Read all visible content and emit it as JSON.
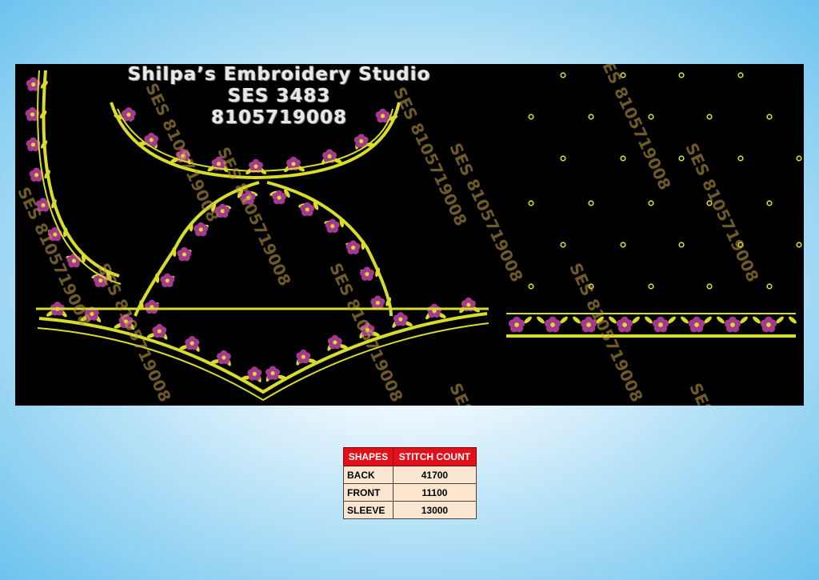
{
  "studio": {
    "name": "Shilpa’s Embroidery Studio",
    "code": "SES 3483",
    "phone": "8105719008"
  },
  "watermark_text": "SES 8105719008",
  "colors": {
    "canvas": "#000000",
    "thread_yellow": "#d8dc2a",
    "flower_purple": "#a4398f",
    "flower_center": "#d8dc2a"
  },
  "table": {
    "headers": [
      "SHAPES",
      "STITCH COUNT"
    ],
    "rows": [
      {
        "shape": "BACK",
        "count": "41700"
      },
      {
        "shape": "FRONT",
        "count": "11100"
      },
      {
        "shape": "SLEEVE",
        "count": "13000"
      }
    ]
  }
}
